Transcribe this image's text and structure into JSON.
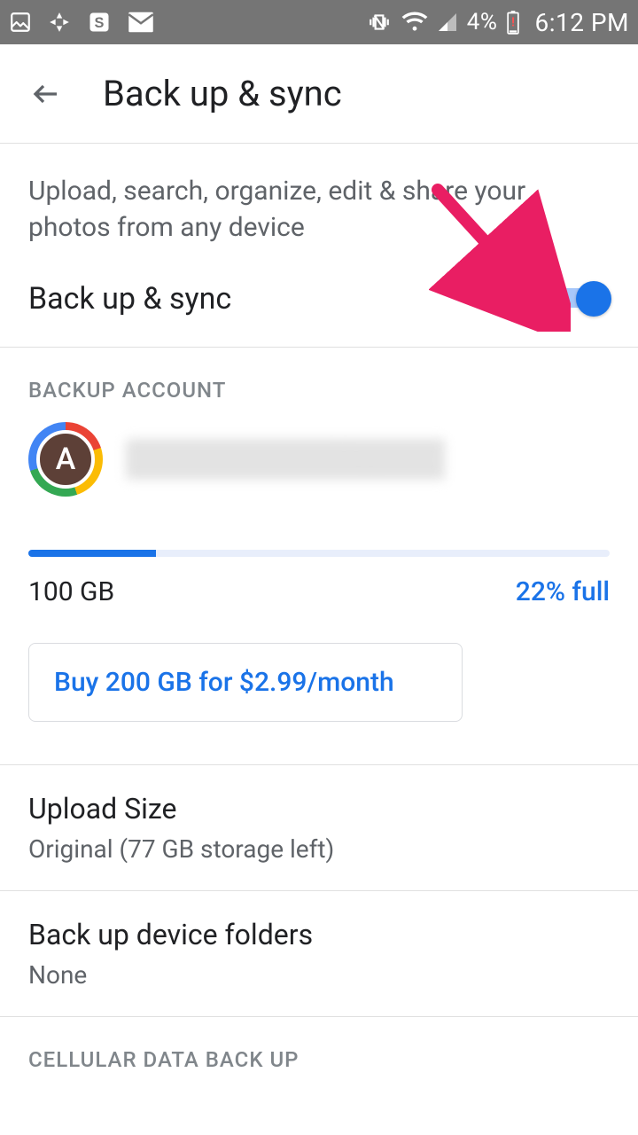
{
  "status_bar": {
    "battery_percent": "4%",
    "time": "6:12 PM"
  },
  "header": {
    "title": "Back up & sync"
  },
  "intro": "Upload, search, organize, edit & share your photos from any device",
  "toggle": {
    "label": "Back up & sync",
    "on": true
  },
  "account_section": {
    "header": "BACKUP ACCOUNT",
    "avatar_letter": "A"
  },
  "storage": {
    "total_label": "100 GB",
    "percent_label": "22% full",
    "percent_value": 22
  },
  "upsell": {
    "label": "Buy 200 GB for $2.99/month"
  },
  "items": [
    {
      "primary": "Upload Size",
      "secondary": "Original (77 GB storage left)"
    },
    {
      "primary": "Back up device folders",
      "secondary": "None"
    }
  ],
  "cellular_header": "CELLULAR DATA BACK UP"
}
